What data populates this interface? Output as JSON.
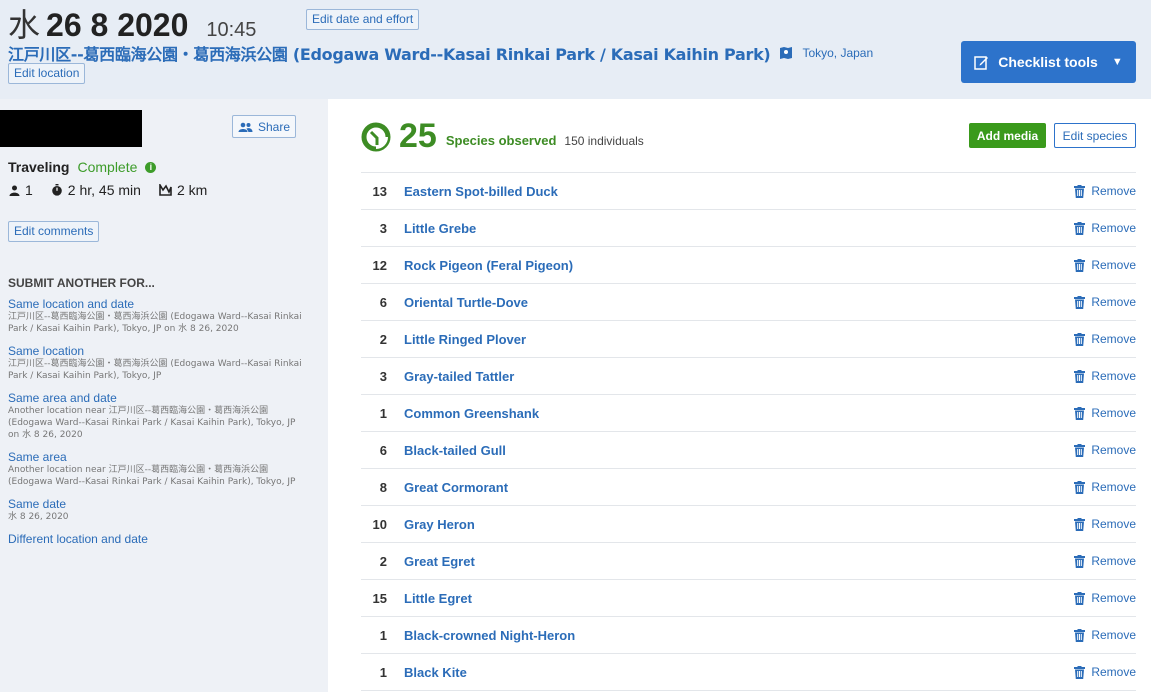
{
  "header": {
    "day_of_week": "水",
    "date": "26 8 2020",
    "time": "10:45",
    "edit_date_label": "Edit date and effort",
    "location_name": "江戸川区--葛西臨海公園・葛西海浜公園 (Edogawa Ward--Kasai Rinkai Park / Kasai Kaihin Park)",
    "region": "Tokyo,  Japan",
    "edit_location_label": "Edit location",
    "checklist_tools_label": "Checklist tools"
  },
  "sidebar": {
    "share_label": "Share",
    "protocol": "Traveling",
    "status": "Complete",
    "observers": "1",
    "duration": "2 hr, 45 min",
    "distance": "2 km",
    "edit_comments_label": "Edit comments",
    "submit_title": "SUBMIT ANOTHER FOR...",
    "submit_items": [
      {
        "label": "Same location and date",
        "desc": "江戸川区--葛西臨海公園・葛西海浜公園 (Edogawa Ward--Kasai Rinkai Park / Kasai Kaihin Park), Tokyo, JP on 水 8 26, 2020"
      },
      {
        "label": "Same location",
        "desc": "江戸川区--葛西臨海公園・葛西海浜公園 (Edogawa Ward--Kasai Rinkai Park / Kasai Kaihin Park), Tokyo, JP"
      },
      {
        "label": "Same area and date",
        "desc": "Another location near 江戸川区--葛西臨海公園・葛西海浜公園 (Edogawa Ward--Kasai Rinkai Park / Kasai Kaihin Park), Tokyo, JP on 水 8 26, 2020"
      },
      {
        "label": "Same area",
        "desc": "Another location near 江戸川区--葛西臨海公園・葛西海浜公園 (Edogawa Ward--Kasai Rinkai Park / Kasai Kaihin Park), Tokyo, JP"
      },
      {
        "label": "Same date",
        "desc": "水 8 26, 2020"
      },
      {
        "label": "Different location and date",
        "desc": ""
      }
    ]
  },
  "main": {
    "species_count": "25",
    "species_label": "Species observed",
    "individuals_label": "150 individuals",
    "add_media_label": "Add media",
    "edit_species_label": "Edit species",
    "remove_label": "Remove",
    "species": [
      {
        "count": "13",
        "name": "Eastern Spot-billed Duck"
      },
      {
        "count": "3",
        "name": "Little Grebe"
      },
      {
        "count": "12",
        "name": "Rock Pigeon (Feral Pigeon)"
      },
      {
        "count": "6",
        "name": "Oriental Turtle-Dove"
      },
      {
        "count": "2",
        "name": "Little Ringed Plover"
      },
      {
        "count": "3",
        "name": "Gray-tailed Tattler"
      },
      {
        "count": "1",
        "name": "Common Greenshank"
      },
      {
        "count": "6",
        "name": "Black-tailed Gull"
      },
      {
        "count": "8",
        "name": "Great Cormorant"
      },
      {
        "count": "10",
        "name": "Gray Heron"
      },
      {
        "count": "2",
        "name": "Great Egret"
      },
      {
        "count": "15",
        "name": "Little Egret"
      },
      {
        "count": "1",
        "name": "Black-crowned Night-Heron"
      },
      {
        "count": "1",
        "name": "Black Kite"
      }
    ]
  },
  "colors": {
    "accent_blue": "#2d73cb",
    "brand_green": "#3d8c24",
    "header_bg": "#e7edf5",
    "sidebar_bg": "#eef1f6"
  },
  "icons": [
    "map-icon",
    "edit-icon",
    "caret-down-icon",
    "share-people-icon",
    "info-icon",
    "person-icon",
    "stopwatch-icon",
    "distance-icon",
    "species-ring-icon",
    "trash-icon"
  ]
}
